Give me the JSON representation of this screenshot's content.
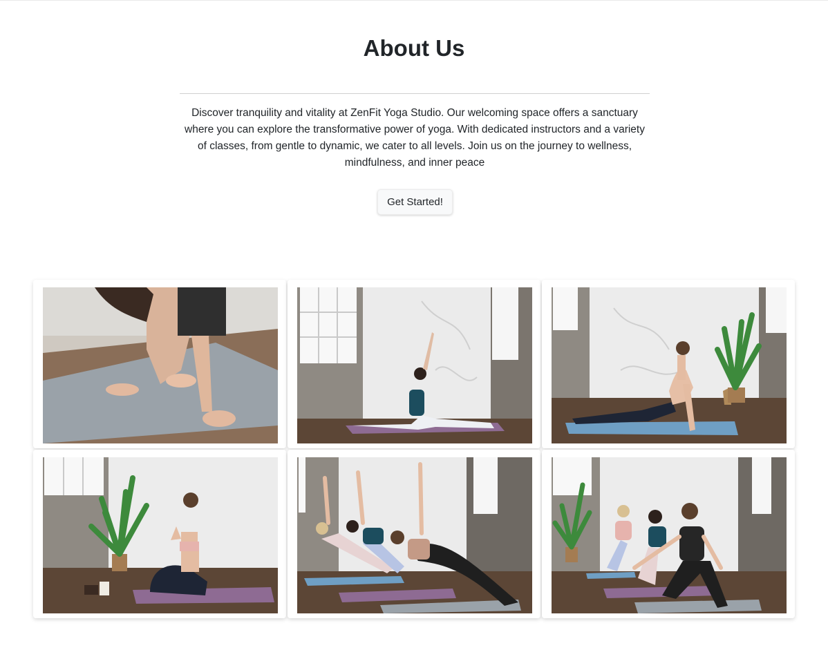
{
  "about": {
    "title": "About Us",
    "description": "Discover tranquility and vitality at ZenFit Yoga Studio. Our welcoming space offers a sanctuary where you can explore the transformative power of yoga. With dedicated instructors and a variety of classes, from gentle to dynamic, we cater to all levels. Join us on the journey to wellness, mindfulness, and inner peace",
    "cta_label": "Get Started!"
  },
  "colors": {
    "text": "#212529",
    "divider": "#cfcfcf",
    "button_bg": "#f8f9fa",
    "mat_blue": "#6f9fc4",
    "mat_purple": "#8e6b93",
    "floor": "#5c4636",
    "marble": "#eeeeee",
    "plant": "#3d8a3c"
  },
  "gallery": [
    {
      "subject": "hands-on-mat-photo"
    },
    {
      "subject": "split-pose-photo"
    },
    {
      "subject": "cobra-pose-photo"
    },
    {
      "subject": "kneeling-prayer-photo"
    },
    {
      "subject": "side-plank-group-photo"
    },
    {
      "subject": "lunge-group-photo"
    }
  ]
}
